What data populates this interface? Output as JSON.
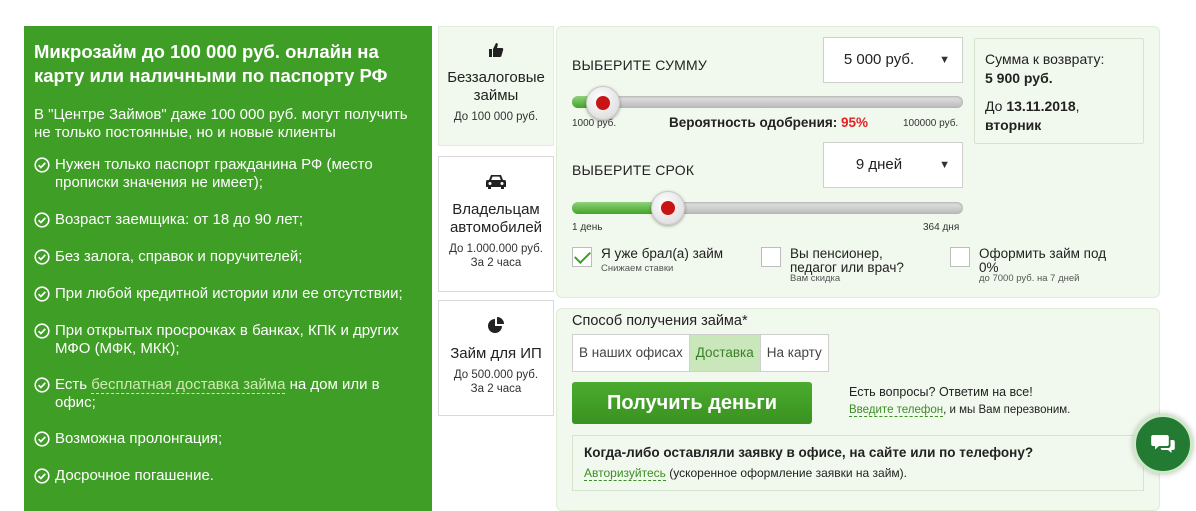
{
  "promo": {
    "title": "Микрозайм до 100 000 руб. онлайн на карту или наличными по паспорту РФ",
    "lead": "В \"Центре Займов\" даже 100 000 руб. могут получить не только постоянные, но и новые клиенты",
    "items": [
      "Нужен только паспорт гражданина РФ (место прописки значения не имеет);",
      "Возраст заемщика: от 18 до 90 лет;",
      "Без залога, справок и поручителей;",
      "При любой кредитной истории или ее отсутствии;",
      "При открытых просрочках в банках, КПК и других МФО (МФК, МКК);"
    ],
    "delivery_prefix": "Есть ",
    "delivery_link": "бесплатная доставка займа",
    "delivery_suffix": " на дом или в офис;",
    "items_after": [
      "Возможна пролонгация;",
      "Досрочное погашение."
    ]
  },
  "products": [
    {
      "icon": "thumbs-up-icon",
      "title": "Беззалоговые займы",
      "sub": "До 100 000 руб.",
      "sub2": ""
    },
    {
      "icon": "car-icon",
      "title": "Владельцам автомобилей",
      "sub": "До 1.000.000 руб.",
      "sub2": "За 2 часа"
    },
    {
      "icon": "pie-chart-icon",
      "title": "Займ для ИП",
      "sub": "До 500.000 руб.",
      "sub2": "За 2 часа"
    }
  ],
  "calc": {
    "amount_label": "ВЫБЕРИТЕ СУММУ",
    "amount_value": "5 000 руб.",
    "amount_min": "1000 руб.",
    "amount_max": "100000 руб.",
    "amount_fraction": 0.04,
    "probability_label": "Вероятность одобрения: ",
    "probability_value": "95%",
    "term_label": "ВЫБЕРИТЕ СРОК",
    "term_value": "9 дней",
    "term_min": "1 день",
    "term_max": "364 дня",
    "term_fraction": 0.22,
    "return_label": "Сумма к возврату:",
    "return_value": "5 900 руб.",
    "until_prefix": "До ",
    "until_date": "13.11.2018",
    "until_day": "вторник",
    "checkboxes": [
      {
        "label": "Я уже брал(а) займ",
        "sub": "Снижаем ставки",
        "checked": true
      },
      {
        "label": "Вы пенсионер, педагог или врач?",
        "sub": "Вам скидка",
        "checked": false
      },
      {
        "label": "Оформить займ под 0%",
        "sub": "до 7000 руб. на 7 дней",
        "checked": false
      }
    ]
  },
  "delivery": {
    "method_label": "Способ получения займа*",
    "tabs": [
      "В наших офисах",
      "Доставка",
      "На карту"
    ],
    "selected_tab": "Доставка",
    "submit_label": "Получить деньги",
    "questions": "Есть вопросы? Ответим на все!",
    "phone_link": "Введите телефон",
    "phone_suffix": ", и мы Вам перезвоним.",
    "info_title": "Когда-либо оставляли заявку в офисе, на сайте или по телефону?",
    "auth_link": "Авторизуйтесь",
    "auth_suffix": " (ускоренное оформление заявки на займ)."
  },
  "colors": {
    "brand_green": "#3f9e25",
    "panel_bg": "#f1f8ed",
    "accent_red": "#e02222"
  }
}
